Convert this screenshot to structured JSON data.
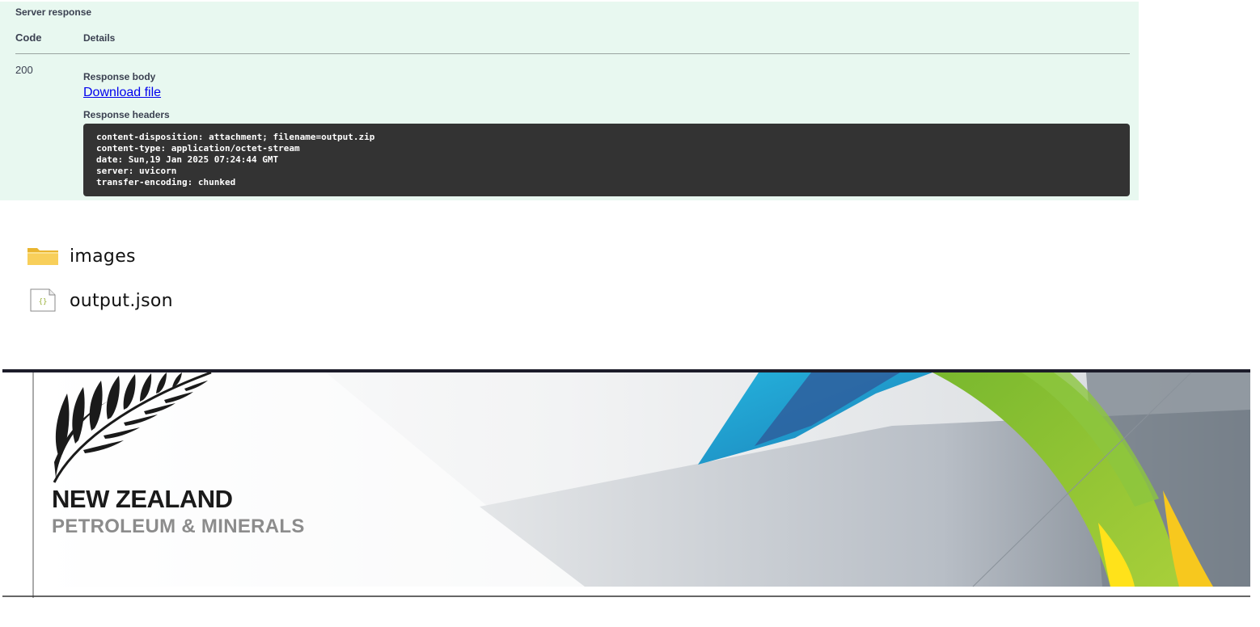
{
  "server_response": {
    "title": "Server response",
    "columns": {
      "code": "Code",
      "details": "Details"
    },
    "status_code": "200",
    "response_body_label": "Response body",
    "download_link": "Download file",
    "response_headers_label": "Response headers",
    "headers": [
      "content-disposition: attachment; filename=output.zip",
      "content-type: application/octet-stream",
      "date: Sun,19 Jan 2025 07:24:44 GMT",
      "server: uvicorn",
      "transfer-encoding: chunked"
    ]
  },
  "files": [
    {
      "name": "images",
      "icon": "folder-icon"
    },
    {
      "name": "output.json",
      "icon": "json-file-icon"
    }
  ],
  "banner": {
    "line1": "NEW ZEALAND",
    "line2": "PETROLEUM & MINERALS"
  },
  "colors": {
    "panel_bg": "#e8f8f0",
    "headers_bg": "#333333",
    "link": "#0000ee",
    "folder": "#f8cf5a",
    "banner_green": "#8cc63f",
    "banner_blue": "#1fa3d1",
    "banner_yellow": "#ffe21a"
  }
}
